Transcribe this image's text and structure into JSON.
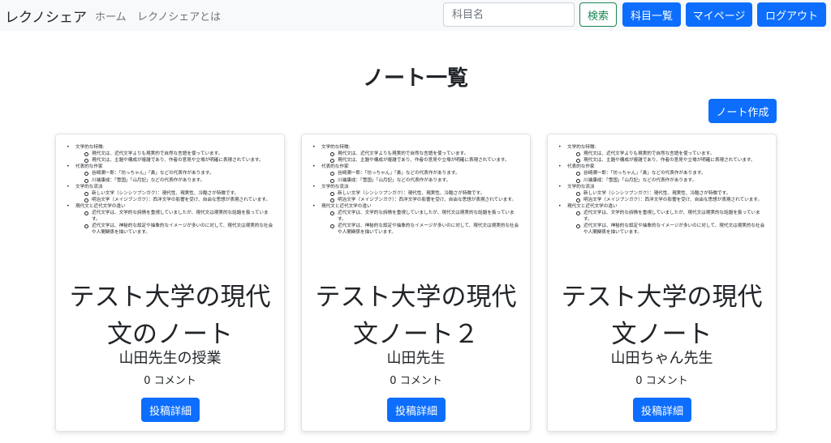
{
  "navbar": {
    "brand": "レクノシェア",
    "links": {
      "home": "ホーム",
      "about": "レクノシェアとは"
    },
    "search": {
      "placeholder": "科目名",
      "value": ""
    },
    "search_button": "検索",
    "subjects_button": "科目一覧",
    "mypage_button": "マイページ",
    "logout_button": "ログアウト"
  },
  "main": {
    "title": "ノート一覧",
    "create_button": "ノート作成"
  },
  "preview": {
    "sections": [
      {
        "heading": "文学的な特徴:",
        "items": [
          "現代文は、近代文学よりも現実的で自然な言語を使っています。",
          "現代文は、主題や構成が複雑であり、作者の意見や立場が明確に表現されています。"
        ]
      },
      {
        "heading": "代表的な作家",
        "items": [
          "谷崎潤一郎：「坊っちゃん」「鼻」などの代表作があります。",
          "川端康成：「雪国」「山月記」などの代表作があります。"
        ]
      },
      {
        "heading": "文学的な流派",
        "items": [
          "新しい文学（シンシツブンガク）：現代性、現実性、冷酷さが特徴です。",
          "明治文学（メイジブンガク）：西洋文学の影響を受け、自由な思想が表現されています。"
        ]
      },
      {
        "heading": "現代文と近代文学の違い",
        "items": [
          "近代文学は、文学的な詩情を重視していましたが、現代文は現実的な話題を扱っています。",
          "近代文学は、神秘的な設定や抽象的なイメージが多いのに対して、現代文は現実的な社会や人間関係を描いています。"
        ]
      }
    ]
  },
  "cards": [
    {
      "title": "テスト大学の現代文のノート",
      "teacher": "山田先生の授業",
      "comments": "0 コメント",
      "detail_button": "投稿詳細"
    },
    {
      "title": "テスト大学の現代文ノート２",
      "teacher": "山田先生",
      "comments": "0 コメント",
      "detail_button": "投稿詳細"
    },
    {
      "title": "テスト大学の現代文ノート",
      "teacher": "山田ちゃん先生",
      "comments": "0 コメント",
      "detail_button": "投稿詳細"
    }
  ]
}
